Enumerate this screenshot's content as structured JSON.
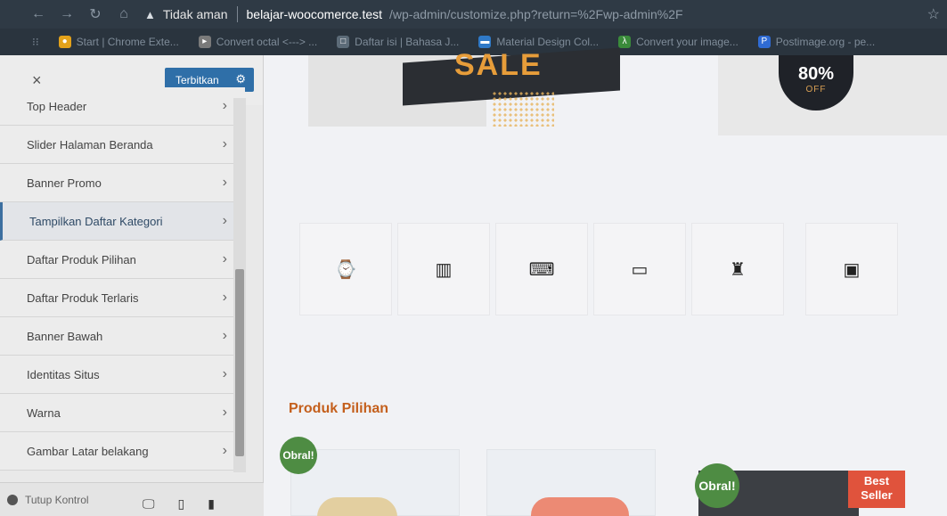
{
  "browser": {
    "insecure_label": "Tidak aman",
    "url_host": "belajar-woocomerce.test",
    "url_path": "/wp-admin/customize.php?return=%2Fwp-admin%2F",
    "bookmarks": [
      {
        "label": "Start | Chrome Exte...",
        "color": "#e3a21a"
      },
      {
        "label": "Convert octal <---> ...",
        "color": "#7a7a7a"
      },
      {
        "label": "Daftar isi | Bahasa J...",
        "color": "#5c6b78"
      },
      {
        "label": "Material Design Col...",
        "color": "#2f79c7"
      },
      {
        "label": "Convert your image...",
        "color": "#3a8b3a"
      },
      {
        "label": "Postimage.org - pe...",
        "color": "#2f6bd4"
      }
    ]
  },
  "customizer": {
    "close_label": "×",
    "publish_label": "Terbitkan",
    "menu": [
      "Top Header",
      "Slider Halaman Beranda",
      "Banner Promo",
      "Tampilkan Daftar Kategori",
      "Daftar Produk Pilihan",
      "Daftar Produk Terlaris",
      "Banner Bawah",
      "Identitas Situs",
      "Warna",
      "Gambar Latar belakang"
    ],
    "active_item": "Tampilkan Daftar Kategori",
    "collapse_label": "Tutup Kontrol"
  },
  "preview": {
    "sale_text": "SALE",
    "discount_pct": "80%",
    "discount_off": "OFF",
    "section_title": "Produk Pilihan",
    "sale_badge": "Obral!",
    "best_seller_line1": "Best",
    "best_seller_line2": "Seller",
    "category_icons": [
      "watch-icon",
      "wardrobe-icon",
      "laptop-icon",
      "laptop-open-icon",
      "figure-icon",
      "image-placeholder-icon"
    ]
  }
}
